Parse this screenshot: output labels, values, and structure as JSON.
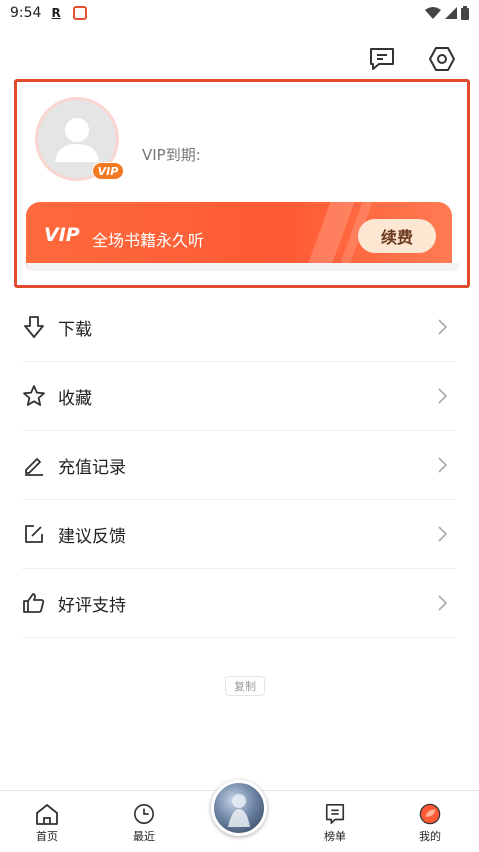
{
  "status_bar": {
    "time": "9:54",
    "carrier_icon": "R"
  },
  "header": {
    "message_icon": "message-icon",
    "settings_icon": "settings-hexagon-icon"
  },
  "profile": {
    "vip_badge": "VIP",
    "vip_expire_label": "VIP到期:"
  },
  "vip_banner": {
    "logo": "VIP",
    "text": "全场书籍永久听",
    "renew_label": "续费"
  },
  "menu": {
    "items": [
      {
        "label": "下载",
        "icon": "download-icon"
      },
      {
        "label": "收藏",
        "icon": "star-icon"
      },
      {
        "label": "充值记录",
        "icon": "edit-icon"
      },
      {
        "label": "建议反馈",
        "icon": "feedback-icon"
      },
      {
        "label": "好评支持",
        "icon": "thumbs-up-icon"
      }
    ]
  },
  "copy_label": "复制",
  "bottom_nav": {
    "items": [
      {
        "label": "首页",
        "icon": "home-icon"
      },
      {
        "label": "最近",
        "icon": "clock-icon"
      },
      {
        "label": "榜单",
        "icon": "list-icon"
      },
      {
        "label": "我的",
        "icon": "profile-icon"
      }
    ]
  },
  "colors": {
    "accent": "#ff5a33",
    "highlight_frame": "#e24a2e",
    "renew_button": "#fde7d2"
  }
}
